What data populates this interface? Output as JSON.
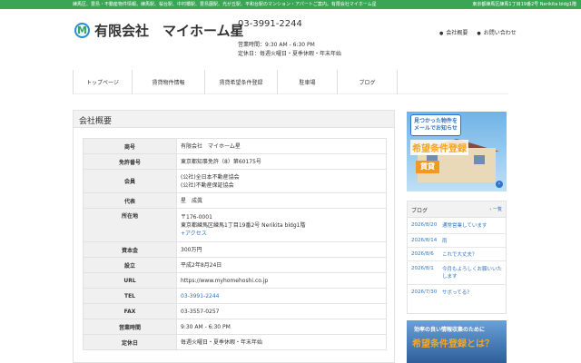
{
  "topbar": {
    "left_text": "練馬区、豊島・不動産物件情報。練馬駅、桜台駅、中村橋駅、豊島園駅、光が丘駅、平和台駅のマンション・アパートご案内。有限会社マイホーム星",
    "right_text": "東京都練馬区練馬1丁目19番2号 Nerikita bldg1階"
  },
  "header": {
    "logo_letter": "M",
    "company_name": "有限会社　マイホーム星",
    "phone": "03-3991-2244",
    "hours_line": "営業時間：9:30 AM - 6:30 PM",
    "holiday_line": "定休日：毎週火曜日・夏季休暇・年末年始",
    "links": [
      "会社概要",
      "お問い合わせ"
    ]
  },
  "nav": [
    "トップページ",
    "賃貸物件情報",
    "賃貸希望条件登録",
    "駐車場",
    "ブログ"
  ],
  "main": {
    "title": "会社概要",
    "rows": [
      {
        "label": "商号",
        "lines": [
          "有限会社　マイホーム星"
        ]
      },
      {
        "label": "免許番号",
        "lines": [
          "東京都知事免許（8）第60175号"
        ]
      },
      {
        "label": "会員",
        "lines": [
          "(公社)全日本不動産協会",
          "(公社)不動産保証協会"
        ]
      },
      {
        "label": "代表",
        "lines": [
          "星　成眞"
        ]
      },
      {
        "label": "所在地",
        "lines": [
          "〒176-0001",
          "東京都練馬区練馬1丁目19番2号 Nerikita bldg1階"
        ],
        "link": "+アクセス"
      },
      {
        "label": "資本金",
        "lines": [
          "300万円"
        ]
      },
      {
        "label": "設立",
        "lines": [
          "平成2年8月24日"
        ]
      },
      {
        "label": "URL",
        "lines": [
          "https://www.myhomehoshi.co.jp"
        ]
      },
      {
        "label": "TEL",
        "lines": [],
        "link": "03-3991-2244"
      },
      {
        "label": "FAX",
        "lines": [
          "03-3557-0257"
        ]
      },
      {
        "label": "営業時間",
        "lines": [
          "9:30 AM - 6:30 PM"
        ]
      },
      {
        "label": "定休日",
        "lines": [
          "毎週火曜日・夏季休暇・年末年始"
        ]
      }
    ]
  },
  "sidebar": {
    "banner_top": {
      "speech": "見つかった物件を\nメールでお知らせ",
      "headline": "希望条件登録",
      "tag": "賃貸"
    },
    "blog": {
      "title": "ブログ",
      "all_link": "一覧",
      "entries": [
        {
          "date": "2026/8/20",
          "title": "通常営業しています"
        },
        {
          "date": "2026/8/14",
          "title": "雨"
        },
        {
          "date": "2026/8/6",
          "title": "これで大丈夫？"
        },
        {
          "date": "2026/8/1",
          "title": "今月もよろしくお願いいたします"
        },
        {
          "date": "2026/7/30",
          "title": "サボってる？"
        }
      ]
    },
    "banner_bottom": {
      "line1": "効率の良い情報収集のために",
      "line2": "希望条件登録とは？"
    }
  },
  "colors": {
    "accent_green": "#3aa655",
    "link_blue": "#2e75c6",
    "header_gray": "#f0f0f0"
  }
}
